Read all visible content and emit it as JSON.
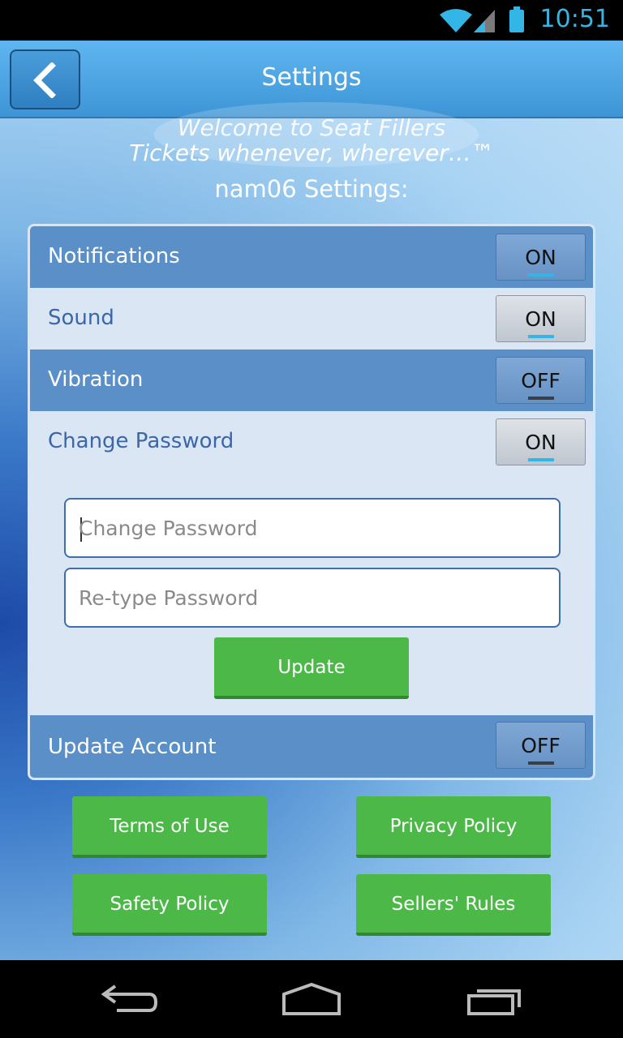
{
  "status_bar": {
    "time": "10:51",
    "icons": [
      "wifi-icon",
      "signal-icon",
      "battery-icon"
    ]
  },
  "header": {
    "title": "Settings",
    "back_icon": "chevron-left-icon"
  },
  "welcome": {
    "line1": "Welcome to Seat Fillers",
    "line2": "Tickets whenever, wherever…™",
    "user_settings": "nam06 Settings:"
  },
  "settings": [
    {
      "label": "Notifications",
      "state": "ON"
    },
    {
      "label": "Sound",
      "state": "ON"
    },
    {
      "label": "Vibration",
      "state": "OFF"
    },
    {
      "label": "Change Password",
      "state": "ON"
    }
  ],
  "password": {
    "new_placeholder": "Change Password",
    "retype_placeholder": "Re-type Password",
    "update_label": "Update"
  },
  "update_account": {
    "label": "Update Account",
    "state": "OFF"
  },
  "links": {
    "terms": "Terms of Use",
    "privacy": "Privacy Policy",
    "safety": "Safety Policy",
    "sellers": "Sellers' Rules"
  },
  "nav_bar": {
    "icons": [
      "back-icon",
      "home-icon",
      "recents-icon"
    ]
  },
  "colors": {
    "accent": "#33b5e5",
    "button_green": "#4cb848",
    "header_blue": "#4aa3e3"
  }
}
